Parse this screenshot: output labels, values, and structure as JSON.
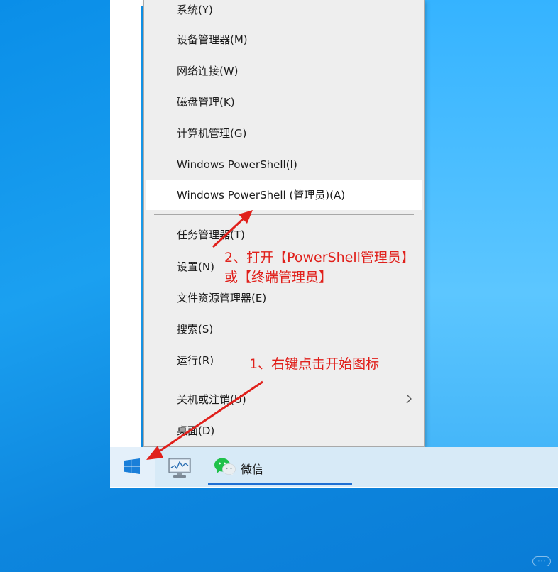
{
  "context_menu": {
    "items": [
      {
        "label": "系统(Y)"
      },
      {
        "label": "设备管理器(M)"
      },
      {
        "label": "网络连接(W)"
      },
      {
        "label": "磁盘管理(K)"
      },
      {
        "label": "计算机管理(G)"
      },
      {
        "label": "Windows PowerShell(I)"
      },
      {
        "label": "Windows PowerShell (管理员)(A)",
        "highlighted": true
      },
      {
        "label": "任务管理器(T)"
      },
      {
        "label": "设置(N)"
      },
      {
        "label": "文件资源管理器(E)"
      },
      {
        "label": "搜索(S)"
      },
      {
        "label": "运行(R)"
      },
      {
        "label": "关机或注销(U)",
        "has_submenu": true
      },
      {
        "label": "桌面(D)"
      }
    ]
  },
  "taskbar": {
    "start_icon": "windows-logo-icon",
    "apps": [
      {
        "icon": "performance-monitor-icon"
      },
      {
        "icon": "wechat-icon",
        "label": "微信"
      }
    ]
  },
  "annotations": {
    "step2_line1": "2、打开【PowerShell管理员】",
    "step2_line2": "或【终端管理员】",
    "step1": "1、右键点击开始图标",
    "color": "#e0201b"
  },
  "colors": {
    "wallpaper": "#0a8ee8",
    "menu_background": "#eeeeee",
    "taskbar_background": "#d7eaf7",
    "accent": "#1f6fd3"
  }
}
